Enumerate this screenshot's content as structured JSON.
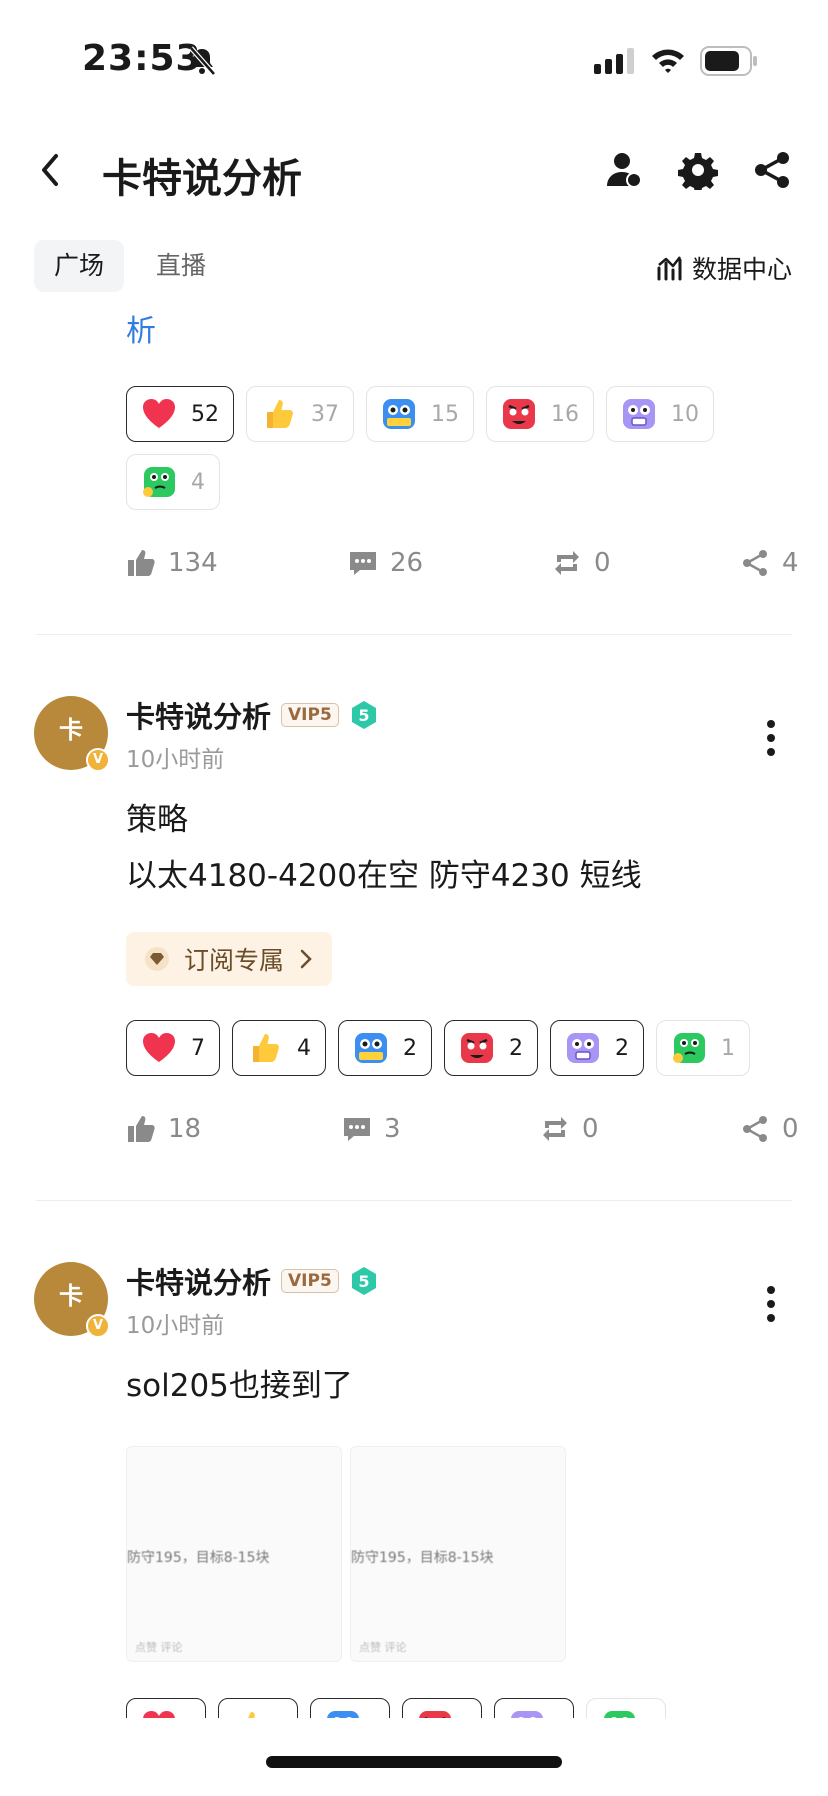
{
  "status_bar": {
    "time": "23:53"
  },
  "header": {
    "title": "卡特说分析"
  },
  "tabs": [
    {
      "label": "广场"
    },
    {
      "label": "直播"
    }
  ],
  "data_center": {
    "label": "数据中心"
  },
  "continued_post": {
    "text_tail": "析",
    "reactions": [
      {
        "icon": "heart-icon",
        "count": "52",
        "selected": true
      },
      {
        "icon": "thumbs-up-emoji-icon",
        "count": "37",
        "selected": false
      },
      {
        "icon": "hodl-robot-emoji-icon",
        "count": "15",
        "selected": false
      },
      {
        "icon": "angry-red-emoji-icon",
        "count": "16",
        "selected": false
      },
      {
        "icon": "purple-shock-emoji-icon",
        "count": "10",
        "selected": false
      },
      {
        "icon": "green-thinking-emoji-icon",
        "count": "4",
        "selected": false
      }
    ],
    "actions": {
      "likes": "134",
      "comments": "26",
      "reposts": "0",
      "shares": "4"
    }
  },
  "posts": [
    {
      "author": "卡特说分析",
      "vip": "VIP5",
      "level": "5",
      "time": "10小时前",
      "lines": [
        "策略",
        "以太4180-4200在空 防守4230 短线"
      ],
      "subscribe_label": "订阅专属",
      "reactions": [
        {
          "icon": "heart-icon",
          "count": "7",
          "selected": true
        },
        {
          "icon": "thumbs-up-emoji-icon",
          "count": "4",
          "selected": true
        },
        {
          "icon": "hodl-robot-emoji-icon",
          "count": "2",
          "selected": true
        },
        {
          "icon": "angry-red-emoji-icon",
          "count": "2",
          "selected": true
        },
        {
          "icon": "purple-shock-emoji-icon",
          "count": "2",
          "selected": true
        },
        {
          "icon": "green-thinking-emoji-icon",
          "count": "1",
          "selected": false
        }
      ],
      "actions": {
        "likes": "18",
        "comments": "3",
        "reposts": "0",
        "shares": "0"
      }
    },
    {
      "author": "卡特说分析",
      "vip": "VIP5",
      "level": "5",
      "time": "10小时前",
      "lines": [
        "sol205也接到了"
      ],
      "images": [
        {
          "caption": "防守195，目标8-15块",
          "footer": "点赞  评论"
        },
        {
          "caption": "防守195，目标8-15块",
          "footer": "点赞  评论"
        }
      ]
    }
  ],
  "colors": {
    "link_blue": "#2f7de1",
    "vip_brown": "#9a6a3e",
    "level_teal": "#2cc8a8"
  }
}
